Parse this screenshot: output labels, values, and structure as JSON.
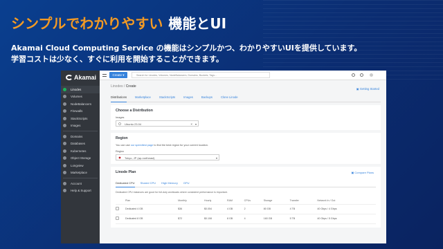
{
  "slide": {
    "title_highlight": "シンプルでわかりやすい",
    "title_rest": "機能とUI",
    "desc_line1": "Akamai Cloud Computing Service の機能はシンプルかつ、わかりやすいUIを提供しています。",
    "desc_line2": "学習コストは少なく、すぐに利用を開始することができます。"
  },
  "app": {
    "logo": "Akamai",
    "create_label": "Create",
    "search_placeholder": "Search for Linodes, Volumes, NodeBalancers, Domains, Buckets, Tags...",
    "sidebar": [
      {
        "label": "Linodes",
        "icon": "linode-icon"
      },
      {
        "label": "Volumes",
        "icon": "volume-icon"
      },
      {
        "label": "NodeBalancers",
        "icon": "nodebalancer-icon"
      },
      {
        "label": "Firewalls",
        "icon": "firewall-icon"
      },
      {
        "label": "StackScripts",
        "icon": "stackscript-icon"
      },
      {
        "label": "Images",
        "icon": "image-icon"
      },
      {
        "label": "Domains",
        "icon": "domain-icon"
      },
      {
        "label": "Databases",
        "icon": "database-icon"
      },
      {
        "label": "Kubernetes",
        "icon": "kubernetes-icon"
      },
      {
        "label": "Object Storage",
        "icon": "storage-icon"
      },
      {
        "label": "Longview",
        "icon": "longview-icon"
      },
      {
        "label": "Marketplace",
        "icon": "marketplace-icon"
      },
      {
        "label": "Account",
        "icon": "account-icon"
      },
      {
        "label": "Help & Support",
        "icon": "help-icon"
      }
    ],
    "breadcrumb_parent": "Linodes",
    "breadcrumb_current": "Create",
    "support_link": "Getting Started",
    "tabs": [
      "Distributions",
      "Marketplace",
      "StackScripts",
      "Images",
      "Backups",
      "Clone Linode"
    ],
    "distribution": {
      "heading": "Choose a Distribution",
      "images_label": "Images",
      "selected": "Ubuntu 23.04"
    },
    "region": {
      "heading": "Region",
      "description_pre": "You can use",
      "description_link": "our speedtest page",
      "description_post": "to find the best region for your current location.",
      "label": "Region",
      "selected": "Tokyo, JP (ap-northeast)"
    },
    "plan": {
      "heading": "Linode Plan",
      "compare_link": "Compare Plans",
      "tabs": [
        "Dedicated CPU",
        "Shared CPU",
        "High Memory",
        "GPU"
      ],
      "note": "Dedicated CPU instances are good for full-duty workloads where consistent performance is important.",
      "columns": [
        "Plan",
        "Monthly",
        "Hourly",
        "RAM",
        "CPUs",
        "Storage",
        "Transfer",
        "Network In / Out"
      ],
      "rows": [
        [
          "Dedicated 4 GB",
          "$36",
          "$0.054",
          "4 GB",
          "2",
          "80 GB",
          "4 TB",
          "40 Gbps / 4 Gbps"
        ],
        [
          "Dedicated 8 GB",
          "$72",
          "$0.108",
          "8 GB",
          "4",
          "160 GB",
          "5 TB",
          "40 Gbps / 5 Gbps"
        ]
      ]
    }
  }
}
